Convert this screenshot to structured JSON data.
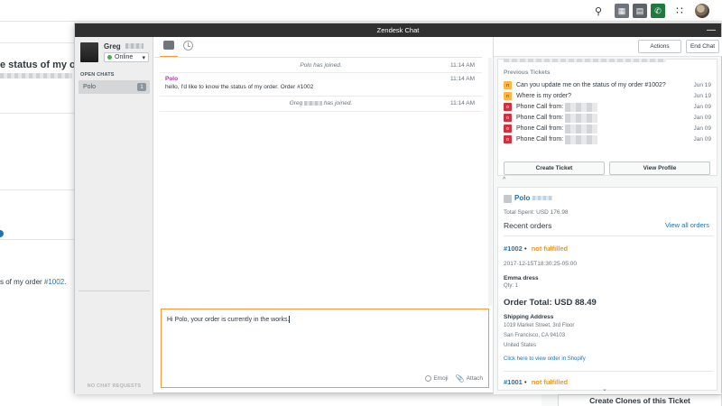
{
  "topbar": {
    "icons": [
      "search-icon",
      "views-icon",
      "chat-icon",
      "phone-icon",
      "apps-icon",
      "user-avatar"
    ]
  },
  "background": {
    "ticket_title": "e status of my ord",
    "ticket_text": "s of my order ",
    "ticket_link": "#1002",
    "ticket_text_end": "."
  },
  "chat": {
    "window_title": "Zendesk Chat",
    "minimize": "—",
    "agent": {
      "name": "Greg",
      "status": "Online"
    },
    "open_chats_label": "OPEN CHATS",
    "open_chats": [
      {
        "name": "Polo",
        "count": "1"
      }
    ],
    "no_chat_requests": "NO CHAT REQUESTS",
    "messages": [
      {
        "type": "system",
        "text": "Polo has joined.",
        "time": "11:14 AM"
      },
      {
        "type": "visitor",
        "name": "Polo",
        "text": "hello, I'd like to know the status of my order. Order #1002",
        "time": "11:14 AM"
      },
      {
        "type": "system",
        "text_before": "Greg",
        "text_after": "has joined.",
        "time": "11:14 AM"
      }
    ],
    "compose": {
      "text": "Hi Polo, your order is currently in the works.",
      "emoji_label": "Emoji",
      "attach_label": "Attach"
    }
  },
  "right_panel": {
    "actions_label": "Actions",
    "end_chat_label": "End Chat",
    "previous_tickets_title": "Previous Tickets",
    "tickets": [
      {
        "status": "n",
        "subject": "Can you update me on the status of my order #1002?",
        "date": "Jun 19"
      },
      {
        "status": "n",
        "subject": "Where is my order?",
        "date": "Jun 19"
      },
      {
        "status": "o",
        "subject": "Phone Call from:",
        "date": "Jan 09"
      },
      {
        "status": "o",
        "subject": "Phone Call from:",
        "date": "Jan 09"
      },
      {
        "status": "o",
        "subject": "Phone Call from:",
        "date": "Jan 09"
      },
      {
        "status": "o",
        "subject": "Phone Call from:",
        "date": "Jan 09"
      }
    ],
    "create_ticket_label": "Create Ticket",
    "view_profile_label": "View Profile",
    "collapse_caret": "^",
    "customer": {
      "name": "Polo",
      "total_spent": "Total Spent: USD 176.98",
      "recent_orders_label": "Recent orders",
      "view_all_label": "View all orders"
    },
    "orders": [
      {
        "id": "#1002",
        "bullet": "•",
        "status": "not fulfilled",
        "date": "2017-12-15T18:30:25-05:00",
        "item": "Emma dress",
        "qty": "Qty: 1",
        "total": "Order Total: USD 88.49",
        "shipping_label": "Shipping Address",
        "shipping_lines": [
          "1019 Market Street, 3rd Floor",
          "San Francisco, CA 94103",
          "United States"
        ],
        "shopify_link": "Click here to view order in Shopify"
      },
      {
        "id": "#1001",
        "bullet": "•",
        "status": "not fulfilled"
      }
    ],
    "scroll_down": "⌄"
  },
  "footer": {
    "create_clones_label": "Create Clones of this Ticket"
  }
}
